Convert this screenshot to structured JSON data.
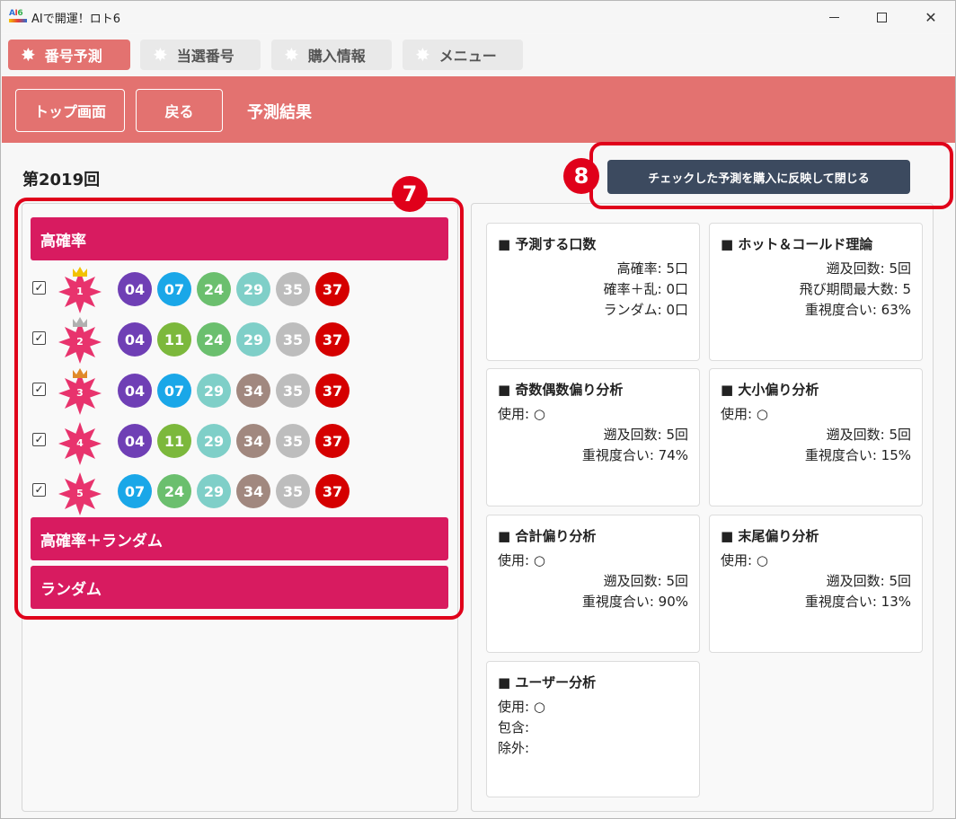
{
  "window": {
    "title": "AIで開運！ロト6"
  },
  "icon_text": [
    "A",
    "I",
    "6"
  ],
  "tabs": [
    {
      "label": "番号予測",
      "active": true
    },
    {
      "label": "当選番号",
      "active": false
    },
    {
      "label": "購入情報",
      "active": false
    },
    {
      "label": "メニュー",
      "active": false
    }
  ],
  "header": {
    "top_button": "トップ画面",
    "back_button": "戻る",
    "title": "予測結果"
  },
  "round_label": "第2019回",
  "purchase_button": "チェックした予測を購入に反映して閉じる",
  "callouts": {
    "seven": "7",
    "eight": "8"
  },
  "sections": {
    "high": "高確率",
    "high_random": "高確率＋ランダム",
    "random": "ランダム"
  },
  "predictions": [
    {
      "rank": "1",
      "checked": true,
      "crown": "gold",
      "numbers": [
        "04",
        "07",
        "24",
        "29",
        "35",
        "37"
      ]
    },
    {
      "rank": "2",
      "checked": true,
      "crown": "silver",
      "numbers": [
        "04",
        "11",
        "24",
        "29",
        "35",
        "37"
      ]
    },
    {
      "rank": "3",
      "checked": true,
      "crown": "bronze",
      "numbers": [
        "04",
        "07",
        "29",
        "34",
        "35",
        "37"
      ]
    },
    {
      "rank": "4",
      "checked": true,
      "crown": "none",
      "numbers": [
        "04",
        "11",
        "29",
        "34",
        "35",
        "37"
      ]
    },
    {
      "rank": "5",
      "checked": true,
      "crown": "none",
      "numbers": [
        "07",
        "24",
        "29",
        "34",
        "35",
        "37"
      ]
    }
  ],
  "ball_colors": {
    "04": "#6f3fb5",
    "07": "#1aa7e8",
    "11": "#7cb83c",
    "24": "#6bbf6e",
    "29": "#7fcfc8",
    "34": "#a1887f",
    "35": "#bdbdbd",
    "37": "#d50000"
  },
  "cards": {
    "count": {
      "title": "■ 予測する口数",
      "l1": "高確率: 5口",
      "l2": "確率＋乱: 0口",
      "l3": "ランダム: 0口"
    },
    "hotcold": {
      "title": "■ ホット＆コールド理論",
      "l1": "遡及回数: 5回",
      "l2": "飛び期間最大数: 5",
      "l3": "重視度合い: 63%"
    },
    "oddeven": {
      "title": "■ 奇数偶数偏り分析",
      "use": "使用: ○",
      "l1": "遡及回数: 5回",
      "l2": "重視度合い: 74%"
    },
    "bigsmall": {
      "title": "■ 大小偏り分析",
      "use": "使用: ○",
      "l1": "遡及回数: 5回",
      "l2": "重視度合い: 15%"
    },
    "sum": {
      "title": "■ 合計偏り分析",
      "use": "使用: ○",
      "l1": "遡及回数: 5回",
      "l2": "重視度合い: 90%"
    },
    "tail": {
      "title": "■ 末尾偏り分析",
      "use": "使用: ○",
      "l1": "遡及回数: 5回",
      "l2": "重視度合い: 13%"
    },
    "user": {
      "title": "■ ユーザー分析",
      "use": "使用: ○",
      "include": "包含:",
      "exclude": "除外:"
    }
  }
}
